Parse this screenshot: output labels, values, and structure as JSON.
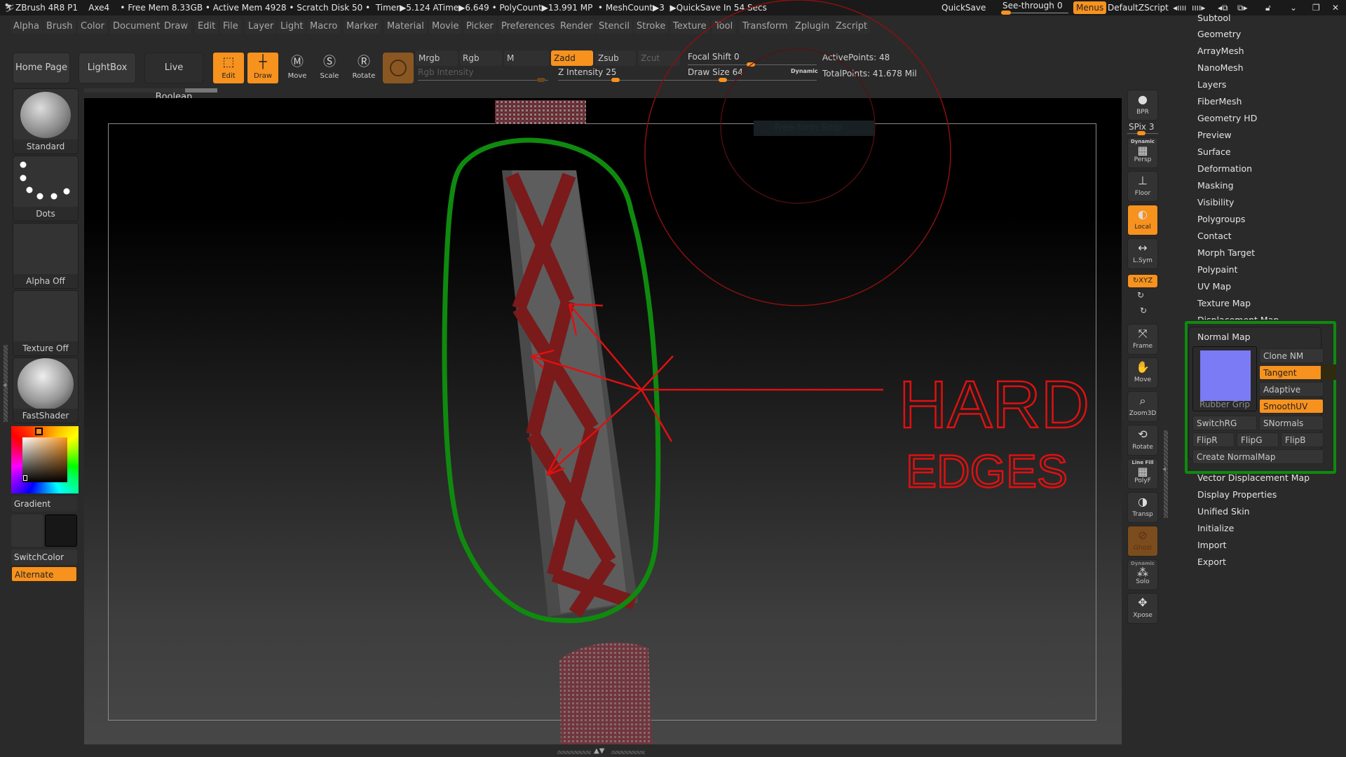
{
  "titlebar": {
    "app_logo": "zbrush-logo-icon",
    "status": "ZBrush 4R8 P1    Axe4    • Free Mem 8.33GB • Active Mem 4928 • Scratch Disk 50 •  Timer▶5.124 ATime▶6.649 • PolyCount▶13.991 MP  • MeshCount▶3  ▶QuickSave In 54 Secs",
    "quicksave": "QuickSave",
    "see_through_label": "See-through",
    "see_through_value": "0",
    "menus": "Menus",
    "script": "DefaultZScript",
    "icons": [
      "shrink-tray-icon",
      "expand-tray-icon",
      "prev-layout-icon",
      "next-layout-icon",
      "lock-icon",
      "minimize-icon",
      "restore-icon",
      "close-icon"
    ]
  },
  "menubar": [
    "Alpha",
    "Brush",
    "Color",
    "Document",
    "Draw",
    "Edit",
    "File",
    "Layer",
    "Light",
    "Macro",
    "Marker",
    "Material",
    "Movie",
    "Picker",
    "Preferences",
    "Render",
    "Stencil",
    "Stroke",
    "Texture",
    "Tool",
    "Transform",
    "Zplugin",
    "Zscript"
  ],
  "toolbar": {
    "home": "Home Page",
    "lightbox": "LightBox",
    "liveboolean": "Live Boolean",
    "edit": "Edit",
    "draw": "Draw",
    "move": "Move",
    "scale": "Scale",
    "rotate": "Rotate",
    "mrgb": "Mrgb",
    "rgb": "Rgb",
    "m": "M",
    "zadd": "Zadd",
    "zsub": "Zsub",
    "zcut": "Zcut",
    "rgb_intensity": "Rgb Intensity",
    "z_intensity_label": "Z Intensity",
    "z_intensity": "25",
    "focal_shift_label": "Focal Shift",
    "focal_shift": "0",
    "draw_size_label": "Draw Size",
    "draw_size": "64",
    "dynamic": "Dynamic",
    "active_points": "ActivePoints: 48",
    "total_points": "TotalPoints: 41.678 Mil"
  },
  "leftpanel": {
    "brush": "Standard",
    "stroke": "Dots",
    "alpha": "Alpha Off",
    "texture": "Texture Off",
    "material": "FastShader",
    "gradient": "Gradient",
    "switchcolor": "SwitchColor",
    "alternate": "Alternate"
  },
  "viewport": {
    "snip_label": "Free-form Snip",
    "annotation_line1": "HARD",
    "annotation_line2": "EDGES"
  },
  "rightshelf": {
    "bpr": "BPR",
    "spix": "SPix 3",
    "dynamic": "Dynamic",
    "persp": "Persp",
    "floor": "Floor",
    "local": "Local",
    "lsym": "L.Sym",
    "xyz": "XYZ",
    "frame": "Frame",
    "move": "Move",
    "zoom3d": "Zoom3D",
    "rotate": "Rotate",
    "linefill": "Line Fill",
    "polyf": "PolyF",
    "transp": "Transp",
    "ghost": "Ghost",
    "dynamic2": "Dynamic",
    "solo": "Solo",
    "xpose": "Xpose"
  },
  "toolpanel": {
    "items_top": [
      "Subtool",
      "Geometry",
      "ArrayMesh",
      "NanoMesh",
      "Layers",
      "FiberMesh",
      "Geometry HD",
      "Preview",
      "Surface",
      "Deformation",
      "Masking",
      "Visibility",
      "Polygroups",
      "Contact",
      "Morph Target",
      "Polypaint",
      "UV Map",
      "Texture Map",
      "Displacement Map"
    ],
    "normal_map": {
      "title": "Normal Map",
      "preview_label": "Rubber Grip",
      "preview_color": "#7b7bf5",
      "clone_nm": "Clone NM",
      "tangent": "Tangent",
      "adaptive": "Adaptive",
      "smoothuv": "SmoothUV",
      "switchrg": "SwitchRG",
      "snormals": "SNormals",
      "flipr": "FlipR",
      "flipg": "FlipG",
      "flipb": "FlipB",
      "create": "Create NormalMap"
    },
    "items_bottom": [
      "Vector Displacement Map",
      "Display Properties",
      "Unified Skin",
      "Initialize",
      "Import",
      "Export"
    ]
  },
  "colors": {
    "accent": "#f7921e",
    "annotation_red": "#e01010",
    "annotation_green": "#0f8a0f"
  }
}
